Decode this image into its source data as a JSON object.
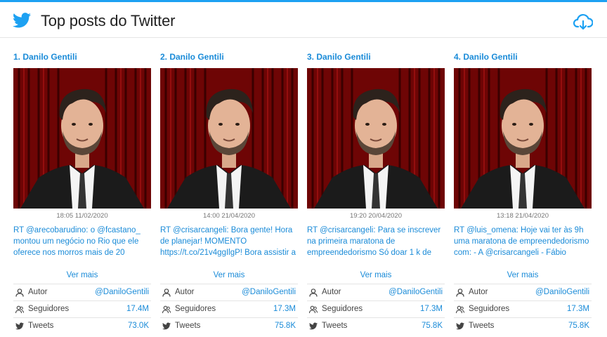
{
  "header": {
    "title": "Top posts do Twitter",
    "icons": {
      "logo": "twitter-bird-icon",
      "download": "cloud-download-icon"
    }
  },
  "colors": {
    "accent": "#1da1f2",
    "link": "#1a8bd8",
    "curtain": "#8b0000"
  },
  "labels": {
    "more": "Ver mais",
    "author": "Autor",
    "followers": "Seguidores",
    "tweets": "Tweets"
  },
  "posts": [
    {
      "name": "1. Danilo Gentili",
      "time": "18:05 11/02/2020",
      "text": "RT @arecobarudino: o @fcastano_ montou um negócio no Rio que ele oferece nos morros mais de 20",
      "author": "@DaniloGentili",
      "followers": "17.4M",
      "tweets": "73.0K"
    },
    {
      "name": "2. Danilo Gentili",
      "time": "14:00 21/04/2020",
      "text": "RT @crisarcangeli: Bora gente! Hora de planejar! MOMENTO https://t.co/21v4ggIlgP! Bora assistir a",
      "author": "@DaniloGentili",
      "followers": "17.3M",
      "tweets": "75.8K"
    },
    {
      "name": "3. Danilo Gentili",
      "time": "19:20 20/04/2020",
      "text": "RT @crisarcangeli: Para se inscrever na primeira maratona de empreendedorismo Só doar 1 k de",
      "author": "@DaniloGentili",
      "followers": "17.3M",
      "tweets": "75.8K"
    },
    {
      "name": "4. Danilo Gentili",
      "time": "13:18 21/04/2020",
      "text": "RT @luis_omena: Hoje vai ter às 9h uma maratona de empreendedorismo com: - A @crisarcangeli - Fábio Coelho",
      "author": "@DaniloGentili",
      "followers": "17.3M",
      "tweets": "75.8K"
    }
  ]
}
